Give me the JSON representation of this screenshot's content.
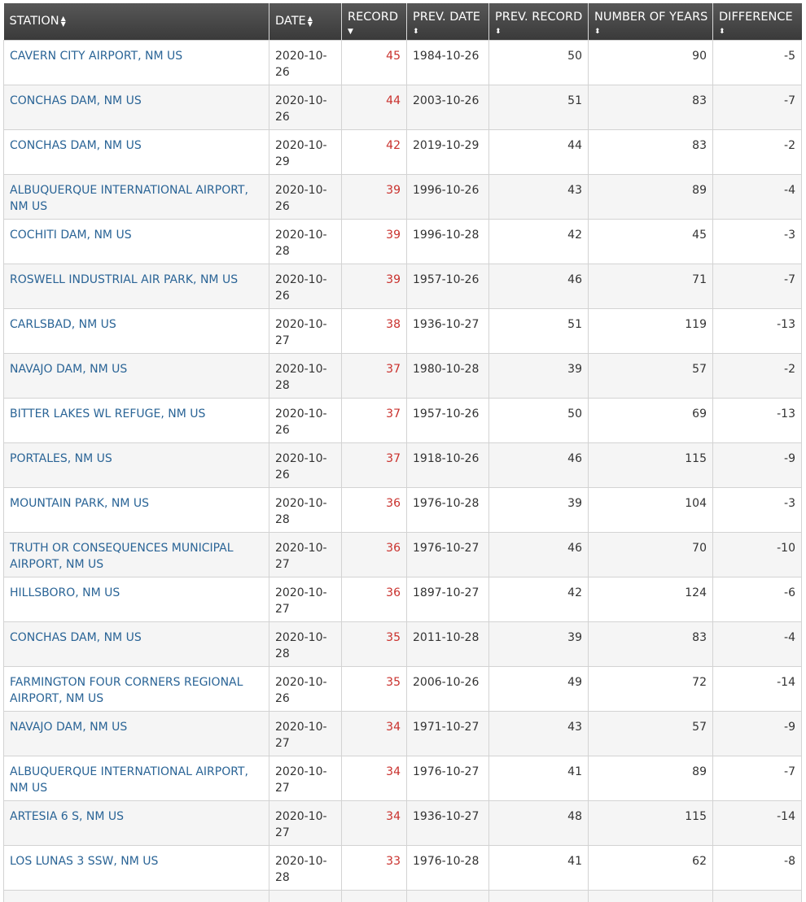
{
  "table": {
    "headers": {
      "station": "STATION",
      "date": "DATE",
      "record": "RECORD",
      "prev_date": "PREV. DATE",
      "prev_record": "PREV. RECORD",
      "years": "NUMBER OF YEARS",
      "difference": "DIFFERENCE"
    },
    "rows": [
      {
        "station": "CAVERN CITY AIRPORT, NM US",
        "date": "2020-10-26",
        "record": "45",
        "prev_date": "1984-10-26",
        "prev_record": "50",
        "years": "90",
        "difference": "-5"
      },
      {
        "station": "CONCHAS DAM, NM US",
        "date": "2020-10-26",
        "record": "44",
        "prev_date": "2003-10-26",
        "prev_record": "51",
        "years": "83",
        "difference": "-7"
      },
      {
        "station": "CONCHAS DAM, NM US",
        "date": "2020-10-29",
        "record": "42",
        "prev_date": "2019-10-29",
        "prev_record": "44",
        "years": "83",
        "difference": "-2"
      },
      {
        "station": "ALBUQUERQUE INTERNATIONAL AIRPORT, NM US",
        "date": "2020-10-26",
        "record": "39",
        "prev_date": "1996-10-26",
        "prev_record": "43",
        "years": "89",
        "difference": "-4"
      },
      {
        "station": "COCHITI DAM, NM US",
        "date": "2020-10-28",
        "record": "39",
        "prev_date": "1996-10-28",
        "prev_record": "42",
        "years": "45",
        "difference": "-3"
      },
      {
        "station": "ROSWELL INDUSTRIAL AIR PARK, NM US",
        "date": "2020-10-26",
        "record": "39",
        "prev_date": "1957-10-26",
        "prev_record": "46",
        "years": "71",
        "difference": "-7"
      },
      {
        "station": "CARLSBAD, NM US",
        "date": "2020-10-27",
        "record": "38",
        "prev_date": "1936-10-27",
        "prev_record": "51",
        "years": "119",
        "difference": "-13"
      },
      {
        "station": "NAVAJO DAM, NM US",
        "date": "2020-10-28",
        "record": "37",
        "prev_date": "1980-10-28",
        "prev_record": "39",
        "years": "57",
        "difference": "-2"
      },
      {
        "station": "BITTER LAKES WL REFUGE, NM US",
        "date": "2020-10-26",
        "record": "37",
        "prev_date": "1957-10-26",
        "prev_record": "50",
        "years": "69",
        "difference": "-13"
      },
      {
        "station": "PORTALES, NM US",
        "date": "2020-10-26",
        "record": "37",
        "prev_date": "1918-10-26",
        "prev_record": "46",
        "years": "115",
        "difference": "-9"
      },
      {
        "station": "MOUNTAIN PARK, NM US",
        "date": "2020-10-28",
        "record": "36",
        "prev_date": "1976-10-28",
        "prev_record": "39",
        "years": "104",
        "difference": "-3"
      },
      {
        "station": "TRUTH OR CONSEQUENCES MUNICIPAL AIRPORT, NM US",
        "date": "2020-10-27",
        "record": "36",
        "prev_date": "1976-10-27",
        "prev_record": "46",
        "years": "70",
        "difference": "-10"
      },
      {
        "station": "HILLSBORO, NM US",
        "date": "2020-10-27",
        "record": "36",
        "prev_date": "1897-10-27",
        "prev_record": "42",
        "years": "124",
        "difference": "-6"
      },
      {
        "station": "CONCHAS DAM, NM US",
        "date": "2020-10-28",
        "record": "35",
        "prev_date": "2011-10-28",
        "prev_record": "39",
        "years": "83",
        "difference": "-4"
      },
      {
        "station": "FARMINGTON FOUR CORNERS REGIONAL AIRPORT, NM US",
        "date": "2020-10-26",
        "record": "35",
        "prev_date": "2006-10-26",
        "prev_record": "49",
        "years": "72",
        "difference": "-14"
      },
      {
        "station": "NAVAJO DAM, NM US",
        "date": "2020-10-27",
        "record": "34",
        "prev_date": "1971-10-27",
        "prev_record": "43",
        "years": "57",
        "difference": "-9"
      },
      {
        "station": "ALBUQUERQUE INTERNATIONAL AIRPORT, NM US",
        "date": "2020-10-27",
        "record": "34",
        "prev_date": "1976-10-27",
        "prev_record": "41",
        "years": "89",
        "difference": "-7"
      },
      {
        "station": "ARTESIA 6 S, NM US",
        "date": "2020-10-27",
        "record": "34",
        "prev_date": "1936-10-27",
        "prev_record": "48",
        "years": "115",
        "difference": "-14"
      },
      {
        "station": "LOS LUNAS 3 SSW, NM US",
        "date": "2020-10-28",
        "record": "33",
        "prev_date": "1976-10-28",
        "prev_record": "41",
        "years": "62",
        "difference": "-8"
      },
      {
        "station": "",
        "date": "",
        "record": "",
        "prev_date": "",
        "prev_record": "",
        "years": "",
        "difference": ""
      }
    ]
  },
  "icons": {
    "sort": "sort-both-icon"
  },
  "colors": {
    "header_bg": "#444444",
    "station_link": "#2a6496",
    "record_value": "#c9302c",
    "row_stripe": "#f5f5f5"
  }
}
